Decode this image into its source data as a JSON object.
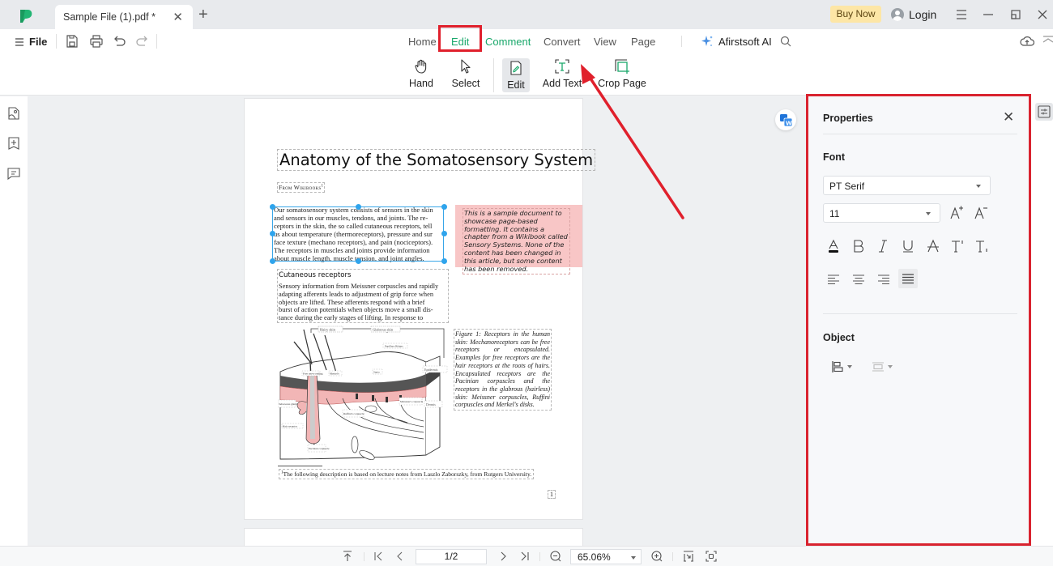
{
  "titlebar": {
    "tab_title": "Sample File (1).pdf *",
    "buy_now": "Buy Now",
    "login": "Login",
    "icons": [
      "app-logo",
      "close-tab-icon",
      "new-tab-icon",
      "hamburger-icon",
      "minimize-icon",
      "restore-icon",
      "close-window-icon"
    ]
  },
  "toolbar": {
    "file_label": "File",
    "quick_icons": [
      "save-icon",
      "print-icon",
      "undo-icon",
      "redo-icon"
    ],
    "menu_tabs": [
      {
        "label": "Home",
        "active": false
      },
      {
        "label": "Edit",
        "active": true
      },
      {
        "label": "Comment",
        "active": false
      },
      {
        "label": "Convert",
        "active": false
      },
      {
        "label": "View",
        "active": false
      },
      {
        "label": "Page",
        "active": false
      }
    ],
    "ai_label": "Afirstsoft AI",
    "tools": [
      {
        "label": "Hand",
        "icon": "hand-icon"
      },
      {
        "label": "Select",
        "icon": "cursor-icon"
      },
      {
        "label": "Edit",
        "icon": "edit-doc-icon",
        "active": true
      },
      {
        "label": "Add Text",
        "icon": "add-text-icon"
      },
      {
        "label": "Crop Page",
        "icon": "crop-icon"
      }
    ]
  },
  "left_rail": [
    "thumbnail-icon",
    "bookmark-icon",
    "comment-icon"
  ],
  "document": {
    "title": "Anatomy of the Somatosensory System",
    "byline": "From Wikibooks",
    "byline_sup": "1",
    "intro_lines": [
      "Our somatosensory system consists of sensors in the skin",
      "and sensors in our muscles, tendons, and joints. The re-",
      "ceptors in the skin, the so called cutaneous receptors, tell",
      "us about temperature (thermoreceptors), pressure and sur",
      "face texture (mechano receptors), and pain (nociceptors).",
      "The receptors in muscles and joints provide information",
      "about muscle length, muscle tension, and joint angles."
    ],
    "note": "This is a sample document to showcase page-based formatting. It contains a chapter from a Wikibook called Sensory Systems. None of the content has been changed in this article, but some content has been removed.",
    "section_heading": "Cutaneous receptors",
    "section_lines": [
      "Sensory information from Meissner corpuscles and rapidly",
      "adapting afferents leads to adjustment of grip force when",
      "objects are lifted. These afferents respond with a brief",
      "burst of action potentials when objects move a small dis-",
      "tance during the early stages of lifting. In response to"
    ],
    "figure_labels": {
      "hairy": "Hairy skin",
      "glabrous": "Glabrous skin",
      "papillary": "Papillary Ridges",
      "epidermis": "Epidermis",
      "dermis": "Dermis",
      "free_nerve": "Free nerve ending",
      "merkel": "Merkel's",
      "septa": "Septa",
      "sebaceous": "Sebaceous gland",
      "meissner": "Meissner's corpuscle",
      "ruffini": "Ruffini's corpuscle",
      "hair_receptor": "Hair receptor",
      "pacinian": "Pacinian corpuscle"
    },
    "caption": "Figure 1: Receptors in the human skin: Mechanoreceptors can be free receptors or encapsulated. Examples for free receptors are the hair receptors at the roots of hairs. Encapsulated receptors are the Pacinian corpuscles and the receptors in the glabrous (hairless) skin: Meissner corpuscles, Ruffini corpuscles and Merkel's disks.",
    "footnote_mark": "1",
    "footnote": "The following description is based on lecture notes from Laszlo Zaborszky, from Rutgers University.",
    "page_number": "1"
  },
  "properties": {
    "title": "Properties",
    "font_section": "Font",
    "font_family": "PT Serif",
    "font_size": "11",
    "style_buttons": [
      "text-color-icon",
      "bold-icon",
      "italic-icon",
      "underline-icon",
      "strikethrough-icon",
      "superscript-icon",
      "subscript-icon"
    ],
    "align_buttons": [
      "align-left-icon",
      "align-center-icon",
      "align-right-icon",
      "align-justify-icon"
    ],
    "active_alignment": "justify",
    "object_section": "Object"
  },
  "statusbar": {
    "page": "1/2",
    "zoom": "65.06%"
  },
  "colors": {
    "accent_green": "#1aa86b",
    "annotation_red": "#d9232f",
    "selection_blue": "#2fa4ec",
    "note_pink": "#f8c6c6",
    "buy_now_bg": "#fde6a6"
  }
}
